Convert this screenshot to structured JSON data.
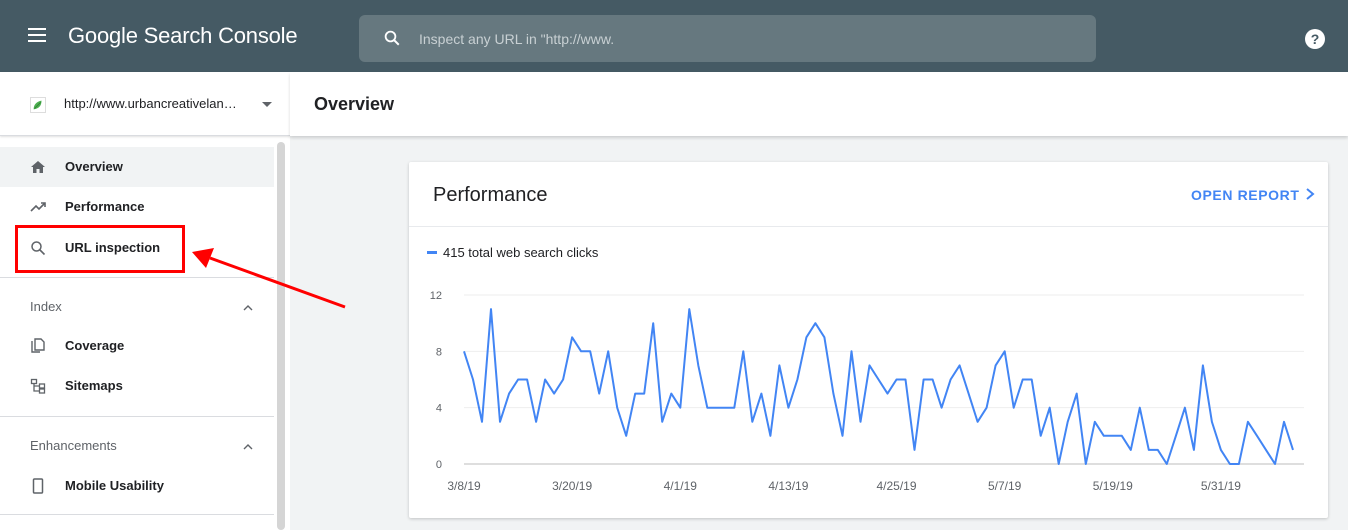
{
  "topbar": {
    "app_title": "Google Search Console",
    "search_placeholder": "Inspect any URL in \"http://www.",
    "help": "?"
  },
  "sidebar": {
    "property_url": "http://www.urbancreativelan…",
    "main_items": [
      {
        "label": "Overview",
        "icon": "home-icon",
        "active": true
      },
      {
        "label": "Performance",
        "icon": "trend-icon"
      },
      {
        "label": "URL inspection",
        "icon": "search-icon"
      }
    ],
    "sections": [
      {
        "title": "Index",
        "items": [
          {
            "label": "Coverage",
            "icon": "coverage-icon"
          },
          {
            "label": "Sitemaps",
            "icon": "sitemap-icon"
          }
        ]
      },
      {
        "title": "Enhancements",
        "items": [
          {
            "label": "Mobile Usability",
            "icon": "phone-icon"
          }
        ]
      }
    ]
  },
  "header": {
    "title": "Overview"
  },
  "card": {
    "title": "Performance",
    "action": "OPEN REPORT",
    "legend": "415 total web search clicks"
  },
  "colors": {
    "topbar": "#455a64",
    "accent": "#4285f4",
    "highlight": "#ff0000"
  },
  "chart_data": {
    "type": "line",
    "series": [
      {
        "name": "415 total web search clicks",
        "values": [
          8,
          6,
          3,
          11,
          3,
          5,
          6,
          6,
          3,
          6,
          5,
          6,
          9,
          8,
          8,
          5,
          8,
          4,
          2,
          5,
          5,
          10,
          3,
          5,
          4,
          11,
          7,
          4,
          4,
          4,
          4,
          8,
          3,
          5,
          2,
          7,
          4,
          6,
          9,
          10,
          9,
          5,
          2,
          8,
          3,
          7,
          6,
          5,
          6,
          6,
          1,
          6,
          6,
          4,
          6,
          7,
          5,
          3,
          4,
          7,
          8,
          4,
          6,
          6,
          2,
          4,
          0,
          3,
          5,
          0,
          3,
          2,
          2,
          2,
          1,
          4,
          1,
          1,
          0,
          2,
          4,
          1,
          7,
          3,
          1,
          0,
          0,
          3,
          2,
          1,
          0,
          3,
          1
        ]
      }
    ],
    "x_tick_labels": [
      "3/8/19",
      "3/20/19",
      "4/1/19",
      "4/13/19",
      "4/25/19",
      "5/7/19",
      "5/19/19",
      "5/31/19"
    ],
    "y_ticks": [
      0,
      4,
      8,
      12
    ],
    "ylim": [
      0,
      12
    ],
    "grid": true
  }
}
